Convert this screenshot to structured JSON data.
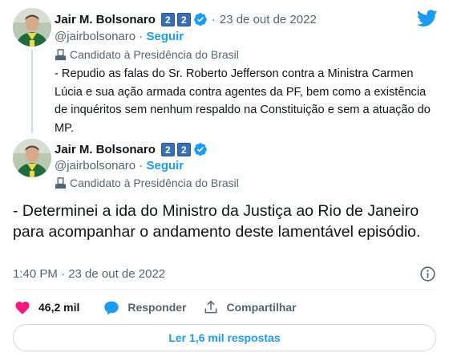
{
  "colors": {
    "accent": "#1d9bf0",
    "like": "#f91880",
    "text_primary": "#0f1419",
    "text_secondary": "#536471",
    "badge": "#3b6fb5"
  },
  "header": {
    "logo_icon": "twitter-bird-icon"
  },
  "quoted_tweet": {
    "author_name": "Jair M. Bolsonaro",
    "badges": [
      "2",
      "2"
    ],
    "verified_icon": "verified-badge-icon",
    "separator": "·",
    "date": "23 de out de 2022",
    "handle": "@jairbolsonaro",
    "handle_separator": " · ",
    "follow_label": "Seguir",
    "account_label": "Candidato à Presidência do Brasil",
    "text": "- Repudio as falas do Sr. Roberto Jefferson contra a Ministra Carmen Lúcia e sua ação armada contra agentes da PF, bem como a existência de inquéritos sem nenhum respaldo na Constituição e sem a atuação do MP."
  },
  "main_tweet": {
    "author_name": "Jair M. Bolsonaro",
    "badges": [
      "2",
      "2"
    ],
    "verified_icon": "verified-badge-icon",
    "handle": "@jairbolsonaro",
    "handle_separator": " · ",
    "follow_label": "Seguir",
    "account_label": "Candidato à Presidência do Brasil",
    "text": "- Determinei a ida do Ministro da Justiça ao Rio de Janeiro para acompanhar o andamento deste lamentável episódio.",
    "timestamp": "1:40 PM · 23 de out de 2022"
  },
  "actions": {
    "likes_count": "46,2 mil",
    "reply_label": "Responder",
    "share_label": "Compartilhar"
  },
  "read_replies_label": "Ler 1,6 mil respostas"
}
